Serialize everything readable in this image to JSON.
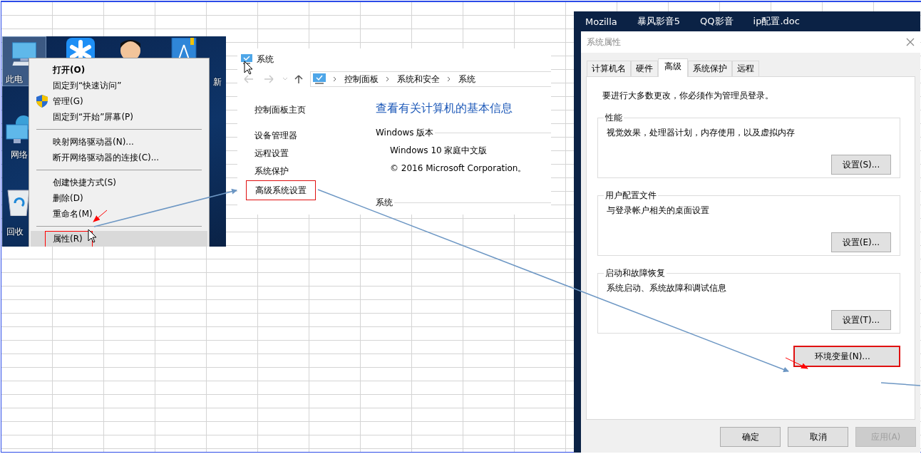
{
  "desktop": {
    "icons": [
      {
        "kind": "computer",
        "label": "此电",
        "selected": true
      },
      {
        "kind": "star_app",
        "selected": false
      },
      {
        "kind": "figure",
        "selected": false
      },
      {
        "kind": "book",
        "label": "新",
        "selected": false
      },
      {
        "kind": "network",
        "label": "网络",
        "selected": false
      },
      {
        "kind": "recycle",
        "label": "回收",
        "selected": false
      }
    ],
    "context_menu": [
      {
        "kind": "item",
        "label": "打开(O)",
        "default": true,
        "highlighted": false,
        "boxed": false
      },
      {
        "kind": "item",
        "label": "固定到“快速访问”",
        "default": false,
        "highlighted": false,
        "boxed": false
      },
      {
        "kind": "shield_item",
        "label": "管理(G)",
        "default": false,
        "highlighted": false,
        "boxed": false
      },
      {
        "kind": "item",
        "label": "固定到“开始”屏幕(P)",
        "default": false,
        "highlighted": false,
        "boxed": false
      },
      {
        "kind": "separator"
      },
      {
        "kind": "item",
        "label": "映射网络驱动器(N)...",
        "default": false,
        "highlighted": false,
        "boxed": false
      },
      {
        "kind": "item",
        "label": "断开网络驱动器的连接(C)...",
        "default": false,
        "highlighted": false,
        "boxed": false
      },
      {
        "kind": "separator"
      },
      {
        "kind": "item",
        "label": "创建快捷方式(S)",
        "default": false,
        "highlighted": false,
        "boxed": false
      },
      {
        "kind": "item",
        "label": "删除(D)",
        "default": false,
        "highlighted": false,
        "boxed": false
      },
      {
        "kind": "item",
        "label": "重命名(M)",
        "default": false,
        "highlighted": false,
        "boxed": false
      },
      {
        "kind": "separator"
      },
      {
        "kind": "item",
        "label": "属性(R)",
        "default": false,
        "highlighted": true,
        "boxed": true
      }
    ]
  },
  "system_window": {
    "title": "系统",
    "breadcrumb": [
      "控制面板",
      "系统和安全",
      "系统"
    ],
    "links": [
      {
        "label": "控制面板主页",
        "boxed": false
      },
      {
        "label": "设备管理器",
        "boxed": false
      },
      {
        "label": "远程设置",
        "boxed": false
      },
      {
        "label": "系统保护",
        "boxed": false
      },
      {
        "label": "高级系统设置",
        "boxed": true
      }
    ],
    "heading": "查看有关计算机的基本信息",
    "sections": [
      {
        "title": "Windows 版本",
        "lines": [
          "Windows 10 家庭中文版",
          "© 2016 Microsoft Corporation。"
        ]
      },
      {
        "title": "系统"
      }
    ]
  },
  "taskbar": [
    "Mozilla",
    "暴风影音5",
    "QQ影音",
    "ip配置.doc"
  ],
  "dialog": {
    "title": "系统属性",
    "tabs": [
      {
        "label": "计算机名",
        "selected": false
      },
      {
        "label": "硬件",
        "selected": false
      },
      {
        "label": "高级",
        "selected": true
      },
      {
        "label": "系统保护",
        "selected": false
      },
      {
        "label": "远程",
        "selected": false
      }
    ],
    "notice": "要进行大多数更改，你必须作为管理员登录。",
    "groups": [
      {
        "title": "性能",
        "description": "视觉效果，处理器计划，内存使用，以及虚拟内存",
        "button": "设置(S)..."
      },
      {
        "title": "用户配置文件",
        "description": "与登录帐户相关的桌面设置",
        "button": "设置(E)..."
      },
      {
        "title": "启动和故障恢复",
        "description": "系统启动、系统故障和调试信息",
        "button": "设置(T)..."
      }
    ],
    "env_button": {
      "label": "环境变量(N)...",
      "boxed": true
    },
    "buttons": [
      {
        "label": "确定",
        "disabled": false
      },
      {
        "label": "取消",
        "disabled": false
      },
      {
        "label": "应用(A)",
        "disabled": true
      }
    ]
  }
}
